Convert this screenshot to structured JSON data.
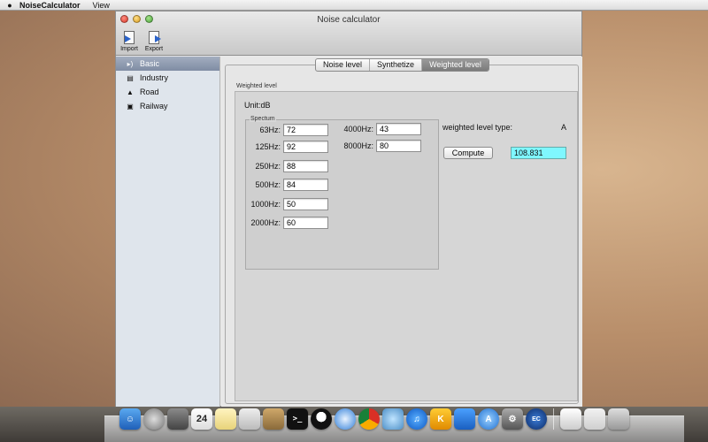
{
  "menubar": {
    "app_name": "NoiseCalculator",
    "menus": [
      "View"
    ]
  },
  "window": {
    "title": "Noise calculator",
    "toolbar": {
      "import_label": "Import",
      "export_label": "Export"
    }
  },
  "sidebar": {
    "items": [
      {
        "label": "Basic",
        "icon": "speaker-icon",
        "selected": true
      },
      {
        "label": "Industry",
        "icon": "factory-icon",
        "selected": false
      },
      {
        "label": "Road",
        "icon": "car-icon",
        "selected": false
      },
      {
        "label": "Railway",
        "icon": "train-icon",
        "selected": false
      }
    ]
  },
  "tabs": [
    {
      "label": "Noise level",
      "active": false
    },
    {
      "label": "Synthetize",
      "active": false
    },
    {
      "label": "Weighted level",
      "active": true
    }
  ],
  "panel": {
    "group_label": "Weighted level",
    "unit_label": "Unit:dB",
    "spectrum_label": "Spectum",
    "fields_left": [
      {
        "label": "63Hz:",
        "value": "72"
      },
      {
        "label": "125Hz:",
        "value": "92"
      },
      {
        "label": "250Hz:",
        "value": "88"
      },
      {
        "label": "500Hz:",
        "value": "84"
      },
      {
        "label": "1000Hz:",
        "value": "50"
      },
      {
        "label": "2000Hz:",
        "value": "60"
      }
    ],
    "fields_right": [
      {
        "label": "4000Hz:",
        "value": "43"
      },
      {
        "label": "8000Hz:",
        "value": "80"
      }
    ],
    "weighted_type_label": "weighted level type:",
    "weighted_type_value": "A",
    "compute_label": "Compute",
    "result_value": "108.831"
  },
  "dock": {
    "calendar_day": "24"
  },
  "colors": {
    "result_bg": "#7ff7ff",
    "sidebar_selected": "#8f9bb0"
  }
}
